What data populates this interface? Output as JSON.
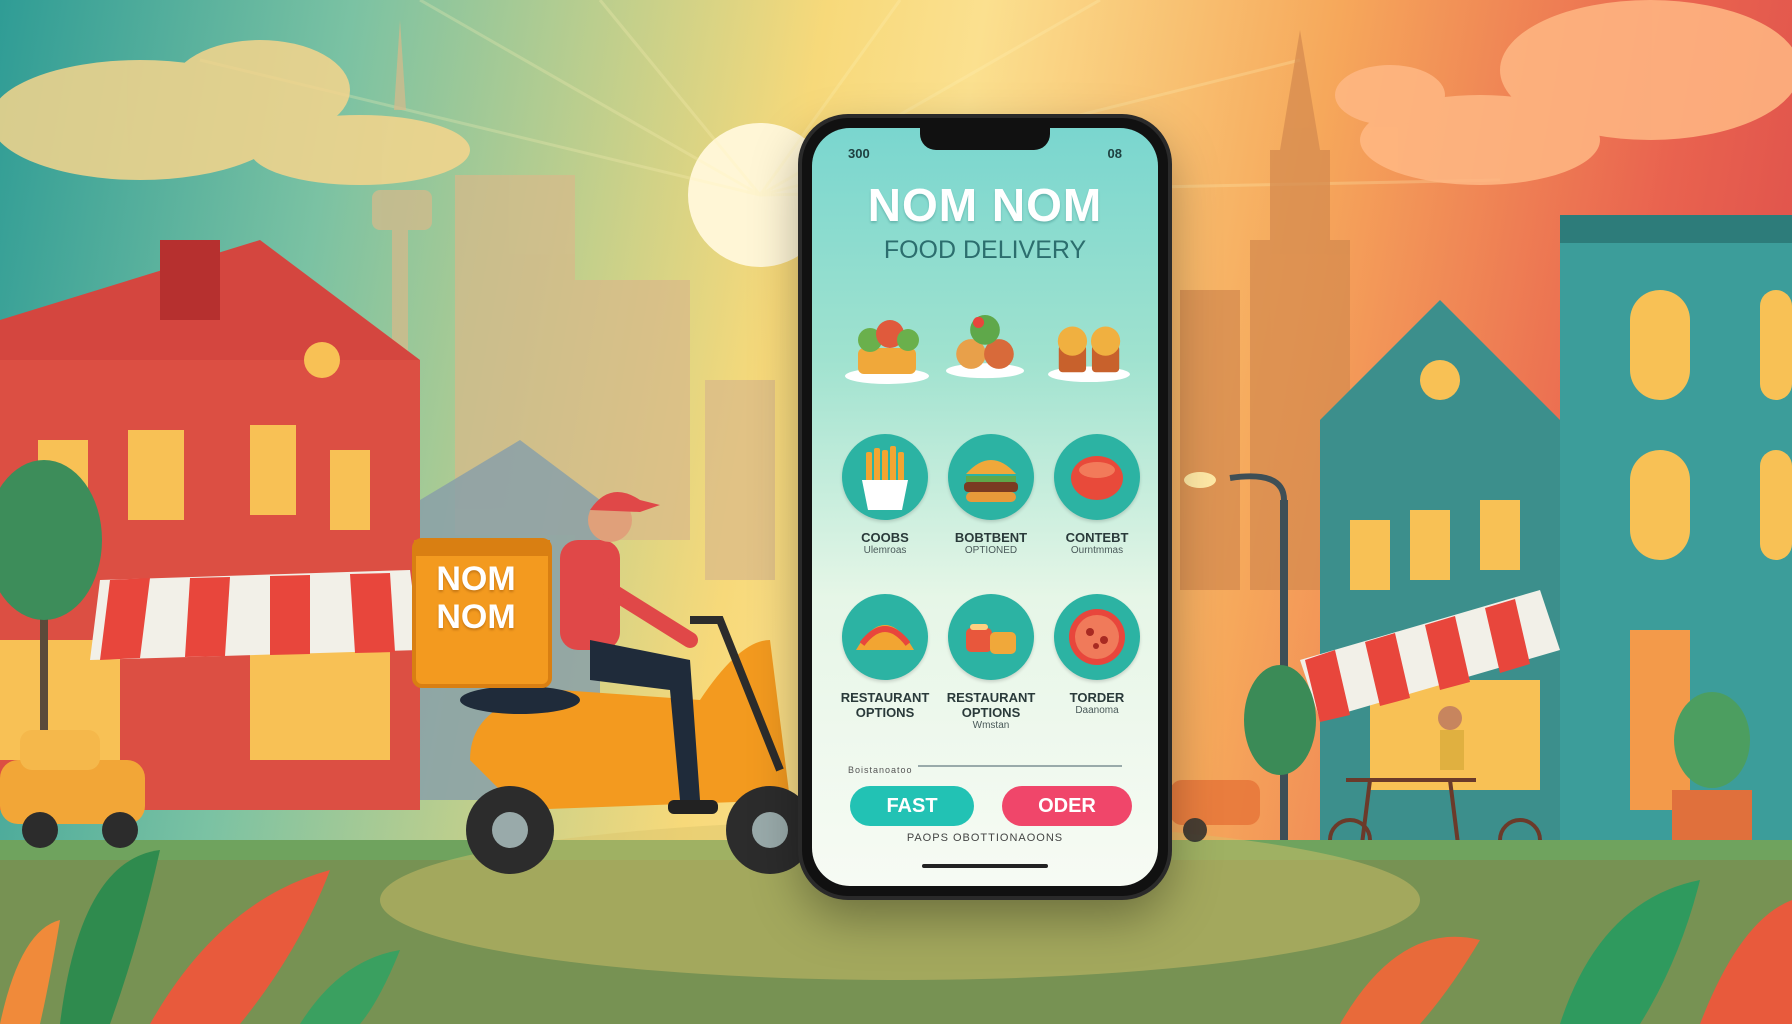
{
  "app": {
    "title": "NOM NOM",
    "subtitle": "FOOD DELIVERY",
    "status_left": "300",
    "status_right": "08"
  },
  "categories": [
    {
      "label": "COOBS",
      "sub": "Ulemroas"
    },
    {
      "label": "BOBTBENT",
      "sub": "OPTIONED"
    },
    {
      "label": "CONTEBT",
      "sub": "Ourntmmas"
    },
    {
      "label": "RESTAURANT OPTIONS",
      "sub": ""
    },
    {
      "label": "RESTAURANT OPTIONS",
      "sub": "Wmstan"
    },
    {
      "label": "TORDER",
      "sub": "Daanoma"
    }
  ],
  "search_text": "Boistanoatoo",
  "buttons": {
    "fast": "FAST",
    "order": "ODER"
  },
  "footer_text": "PAOPS OBOTTIONAOONS",
  "delivery_box_text": "NOM NOM",
  "colors": {
    "accent_teal": "#22c2b4",
    "accent_pink": "#f0466a",
    "scooter": "#f39a1f"
  }
}
